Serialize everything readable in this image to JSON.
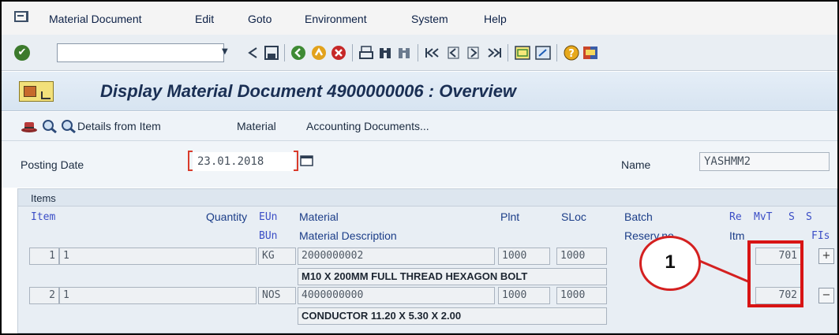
{
  "menu": {
    "items": [
      "Material Document",
      "Edit",
      "Goto",
      "Environment",
      "System",
      "Help"
    ]
  },
  "toolbar": {
    "command_value": ""
  },
  "title": {
    "text": "Display Material Document 4900000006 : Overview"
  },
  "app_toolbar": {
    "details_label": "Details from Item",
    "material_label": "Material",
    "accounting_label": "Accounting Documents..."
  },
  "header": {
    "posting_date_label": "Posting Date",
    "posting_date_value": "23.01.2018",
    "name_label": "Name",
    "name_value": "YASHMM2"
  },
  "items": {
    "title": "Items",
    "headers_row1": {
      "item": "Item",
      "quantity": "Quantity",
      "eun": "EUn",
      "material": "Material",
      "plnt": "Plnt",
      "sloc": "SLoc",
      "batch": "Batch",
      "re": "Re",
      "mvt": "MvT",
      "s1": "S",
      "s2": "S"
    },
    "headers_row2": {
      "bun": "BUn",
      "material_description": "Material Description",
      "reservation": "Reserv.no.",
      "itm": "Itm",
      "fis": "FIs"
    },
    "rows": [
      {
        "item": "1",
        "quantity": "1",
        "unit": "KG",
        "material": "2000000002",
        "plant": "1000",
        "sloc": "1000",
        "mvt": "701",
        "toggle": "+",
        "description": "M10 X 200MM FULL THREAD HEXAGON BOLT"
      },
      {
        "item": "2",
        "quantity": "1",
        "unit": "NOS",
        "material": "4000000000",
        "plant": "1000",
        "sloc": "1000",
        "mvt": "702",
        "toggle": "−",
        "description": "CONDUCTOR 11.20 X 5.30 X 2.00"
      }
    ]
  },
  "annotation": {
    "number": "1"
  }
}
